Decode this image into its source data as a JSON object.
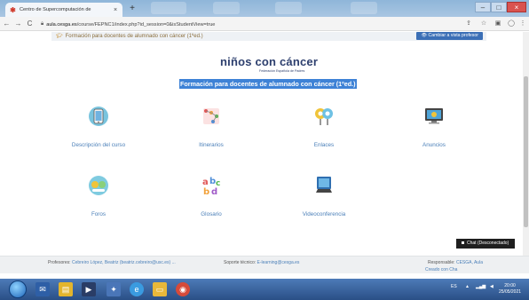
{
  "browser": {
    "tab_title": "Centro de Supercomputación de",
    "tab_close": "×",
    "new_tab": "+",
    "url_host": "aula.cesga.es",
    "url_path": "/course/FEPNC1/index.php?id_session=0&isStudentView=true",
    "min": "–",
    "max": "□",
    "close": "×"
  },
  "course": {
    "name": "Formación para docentes de alumnado con cáncer (1ºed.)",
    "role_button": "Cambiar a vista profesor"
  },
  "logo": {
    "text": "niños con cáncer",
    "subtitle": "Federación Española de Padres"
  },
  "heading": "Formación para docentes de alumnado con cáncer (1ºed.)",
  "tiles": [
    {
      "label": "Descripción del curso",
      "icon": "tablet-icon"
    },
    {
      "label": "Itinerarios",
      "icon": "itinerary-icon"
    },
    {
      "label": "Enlaces",
      "icon": "links-icon"
    },
    {
      "label": "Anuncios",
      "icon": "monitor-icon"
    },
    {
      "label": "Foros",
      "icon": "forum-icon"
    },
    {
      "label": "Glosario",
      "icon": "abc-icon"
    },
    {
      "label": "Videoconferencia",
      "icon": "video-icon"
    }
  ],
  "footer": {
    "teachers_label": "Profesores:",
    "teachers_value": "Cebreiro López, Beatriz (beatriz.cebreiro@usc.es) ...",
    "support_label": "Soporte técnico:",
    "support_value": "E-learning@cesga.es",
    "responsible_label": "Responsable:",
    "responsible_value": "CESGA, Aula",
    "created_label": "Creado con Cha"
  },
  "chat": "Chat (Desconectado)",
  "taskbar": {
    "time": "20:00",
    "date": "25/05/2021",
    "lang": "ES"
  },
  "colors": {
    "accent": "#3e82d6",
    "link": "#4a7fb8",
    "logo": "#2d3f6e"
  }
}
